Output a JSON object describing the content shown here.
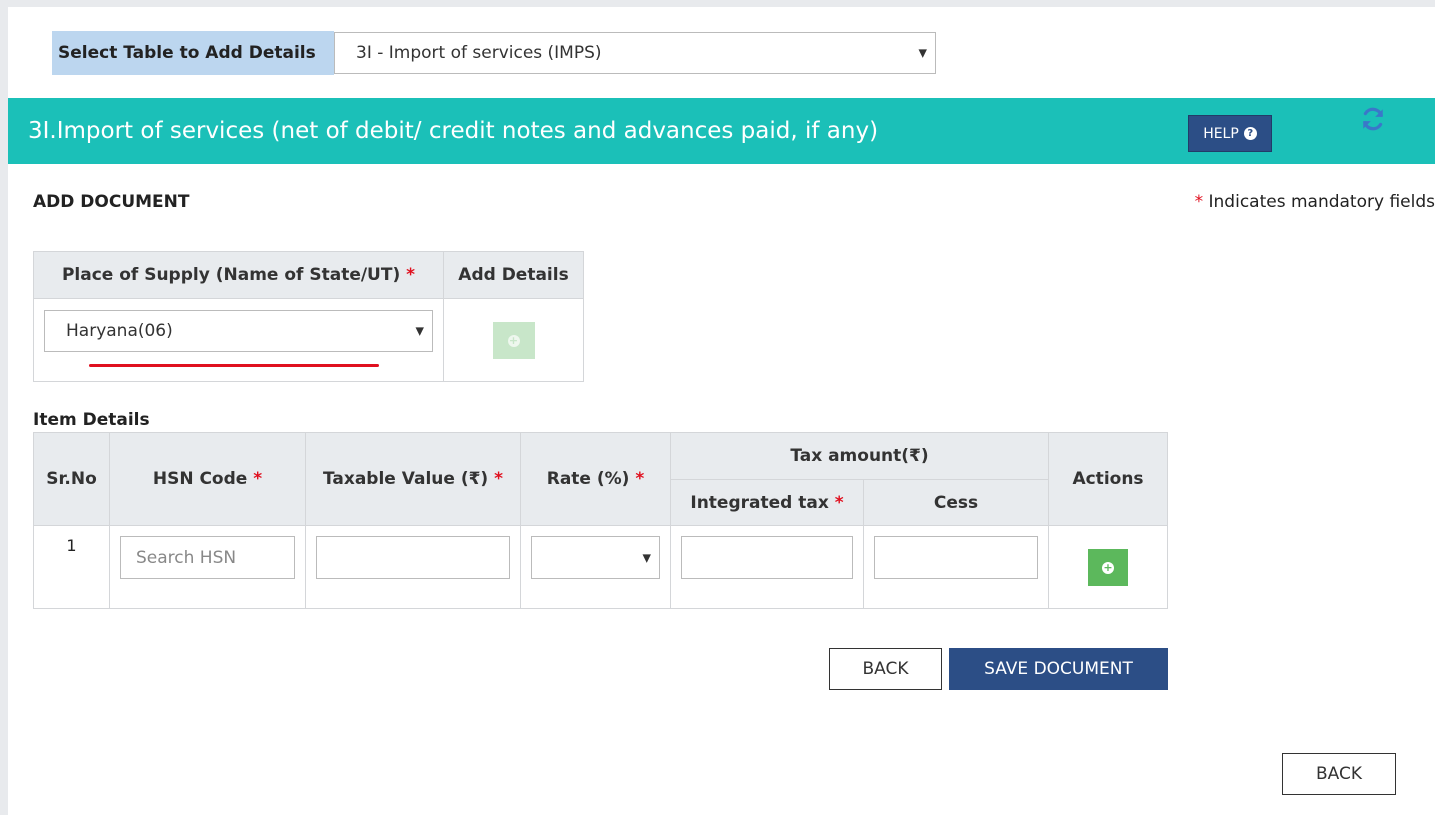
{
  "table_selector": {
    "label": "Select Table to Add Details",
    "selected": "3I - Import of services (IMPS)"
  },
  "section": {
    "title": "3I.Import of services (net of debit/ credit notes and advances paid, if any)",
    "help_label": "HELP",
    "help_icon": "question-circle-icon",
    "refresh_icon": "refresh-icon",
    "bg_color": "#1bc0b8"
  },
  "form": {
    "title": "ADD DOCUMENT",
    "mandatory_star": "*",
    "mandatory_note": "Indicates mandatory fields"
  },
  "place_of_supply": {
    "header": "Place of Supply (Name of State/UT)",
    "required_star": "*",
    "add_details_header": "Add Details",
    "selected": "Haryana(06)"
  },
  "items": {
    "title": "Item Details",
    "headers": {
      "sr_no": "Sr.No",
      "hsn": "HSN Code",
      "taxable_value": "Taxable Value (₹)",
      "rate": "Rate (%)",
      "tax_amount": "Tax amount(₹)",
      "integrated_tax": "Integrated tax",
      "cess": "Cess",
      "actions": "Actions"
    },
    "required_star": "*",
    "rows": [
      {
        "sr_no": "1",
        "hsn_placeholder": "Search HSN",
        "taxable_value": "",
        "rate": "",
        "integrated_tax": "",
        "cess": ""
      }
    ]
  },
  "buttons": {
    "back": "BACK",
    "save": "SAVE DOCUMENT",
    "page_back": "BACK"
  },
  "colors": {
    "primary_button": "#2c4e86",
    "add_button": "#5cb85c",
    "required": "#e0101f"
  }
}
